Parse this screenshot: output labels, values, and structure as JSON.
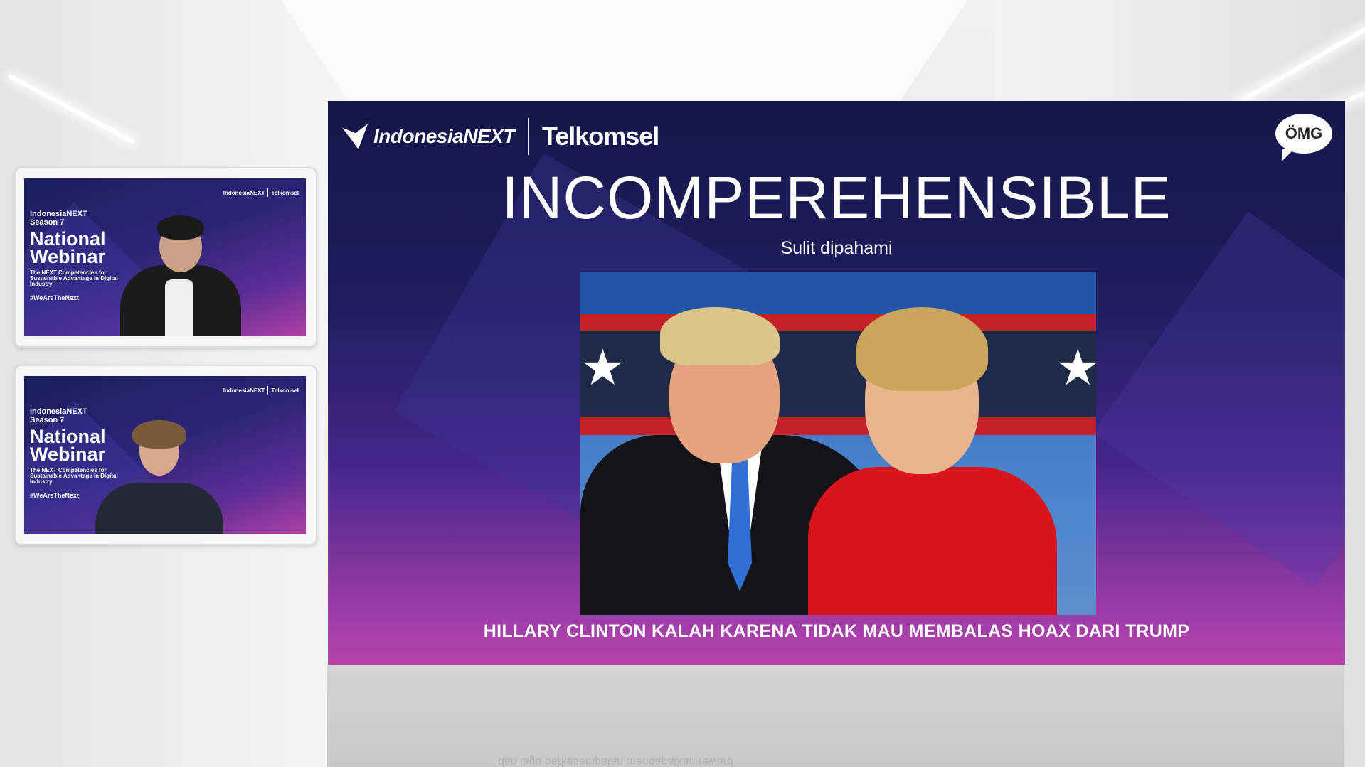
{
  "slide": {
    "brand_indonesia": "IndonesiaNEXT",
    "brand_telkomsel": "Telkomsel",
    "omg_logo": "ÖMG",
    "title": "INCOMPEREHENSIBLE",
    "subtitle": "Sulit dipahami",
    "caption": "HILLARY CLINTON KALAH KARENA TIDAK MAU MEMBALAS HOAX DARI TRUMP",
    "photo_icon": "debate-photo"
  },
  "participants": [
    {
      "logo_left": "IndonesiaNEXT",
      "logo_right": "Telkomsel",
      "event_line1": "IndonesiaNEXT",
      "event_line2": "Season 7",
      "title": "National Webinar",
      "subtitle": "The NEXT Competencies for Sustainable Advantage in Digital Industry",
      "hashtag": "#WeAreTheNext"
    },
    {
      "logo_left": "IndonesiaNEXT",
      "logo_right": "Telkomsel",
      "event_line1": "IndonesiaNEXT",
      "event_line2": "Season 7",
      "title": "National Webinar",
      "subtitle": "The NEXT Competencies for Sustainable Advantage in Digital Industry",
      "hashtag": "#WeAreTheNext"
    }
  ],
  "floor_caption": "dan lagu berkesempatan mendapatkan reward"
}
